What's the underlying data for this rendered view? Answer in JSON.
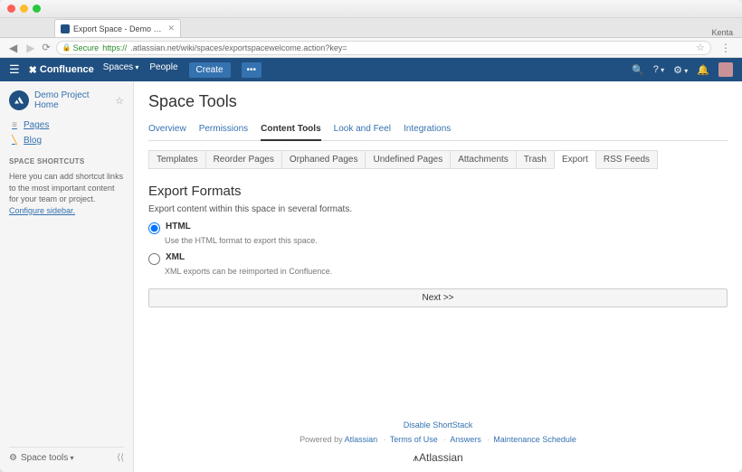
{
  "browser": {
    "tab_title": "Export Space - Demo Projec…",
    "user_name": "Kenta",
    "secure_label": "Secure",
    "protocol": "https://",
    "url_path": ".atlassian.net/wiki/spaces/exportspacewelcome.action?key="
  },
  "header": {
    "product": "Confluence",
    "nav": {
      "spaces": "Spaces",
      "people": "People",
      "create": "Create",
      "more": "•••"
    }
  },
  "sidebar": {
    "space_name": "Demo Project Home",
    "links": {
      "pages": "Pages",
      "blog": "Blog"
    },
    "shortcuts_heading": "SPACE SHORTCUTS",
    "shortcuts_help": "Here you can add shortcut links to the most important content for your team or project. ",
    "configure_link": "Configure sidebar.",
    "footer": "Space tools"
  },
  "page": {
    "title": "Space Tools",
    "tabs": [
      "Overview",
      "Permissions",
      "Content Tools",
      "Look and Feel",
      "Integrations"
    ],
    "active_tab": 2,
    "subtabs": [
      "Templates",
      "Reorder Pages",
      "Orphaned Pages",
      "Undefined Pages",
      "Attachments",
      "Trash",
      "Export",
      "RSS Feeds"
    ],
    "active_subtab": 6,
    "section_title": "Export Formats",
    "section_desc": "Export content within this space in several formats.",
    "options": [
      {
        "value": "html",
        "label": "HTML",
        "desc": "Use the HTML format to export this space.",
        "checked": true
      },
      {
        "value": "xml",
        "label": "XML",
        "desc": "XML exports can be reimported in Confluence.",
        "checked": false
      }
    ],
    "next_button": "Next >>",
    "footer": {
      "disable": "Disable ShortStack",
      "powered": "Powered by ",
      "atlassian": "Atlassian",
      "links": [
        "Terms of Use",
        "Answers",
        "Maintenance Schedule"
      ],
      "brand": "Atlassian"
    }
  }
}
